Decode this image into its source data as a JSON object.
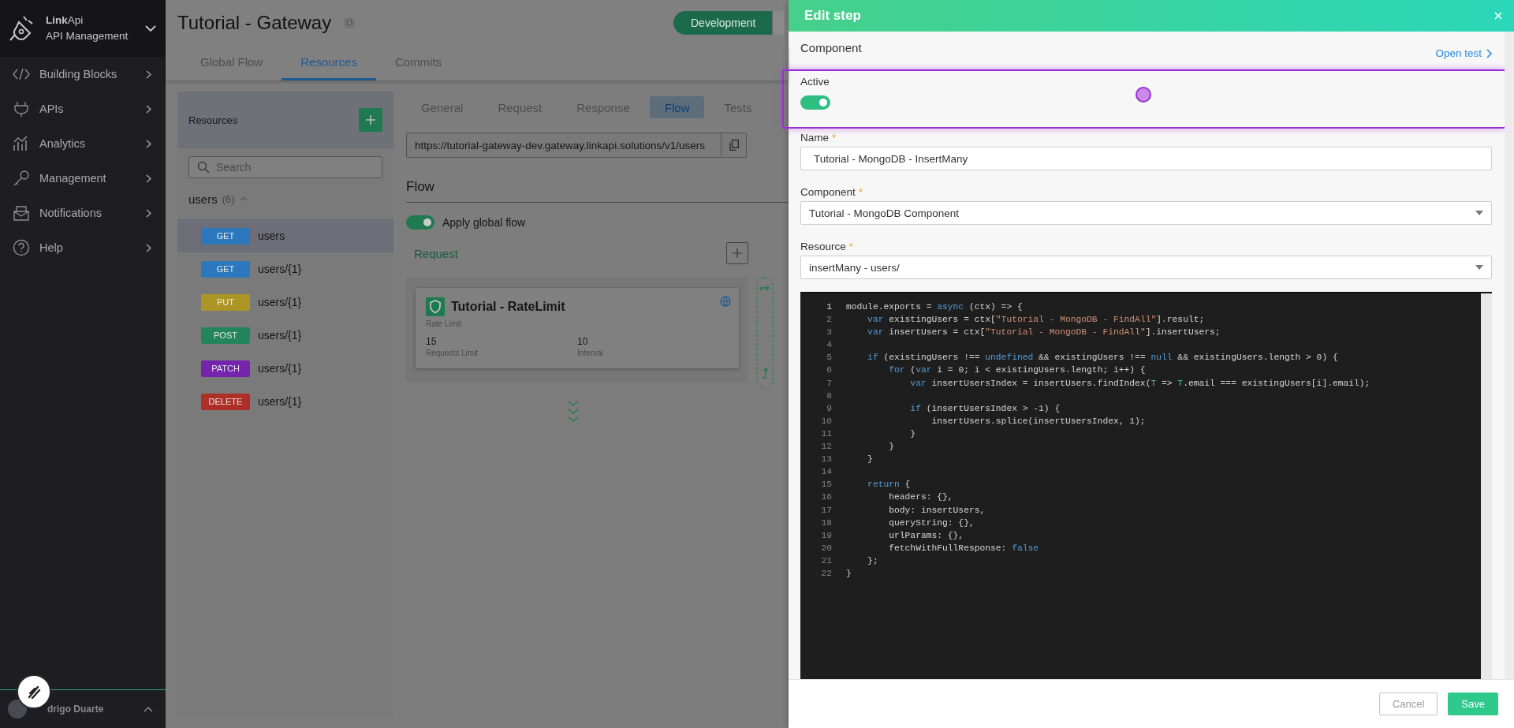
{
  "sidebar": {
    "brand": "**Link**Api",
    "subtitle": "API Management",
    "items": [
      {
        "label": "Building Blocks",
        "kind": "code"
      },
      {
        "label": "APIs",
        "kind": "plug"
      },
      {
        "label": "Analytics",
        "kind": "chart"
      },
      {
        "label": "Management",
        "kind": "key"
      },
      {
        "label": "Notifications",
        "kind": "mail"
      },
      {
        "label": "Help",
        "kind": "help"
      }
    ],
    "user": {
      "name": "drigo Duarte"
    }
  },
  "page": {
    "title": "Tutorial - Gateway",
    "environment": {
      "label": "Development",
      "selected": true
    },
    "tabs": [
      {
        "label": "Global Flow",
        "selected": false
      },
      {
        "label": "Resources",
        "selected": true
      },
      {
        "label": "Commits",
        "selected": false
      }
    ]
  },
  "resources": {
    "title": "Resources",
    "search": {
      "placeholder": "Search"
    },
    "group": {
      "name": "users",
      "count": "(6)",
      "expanded": true
    },
    "items": [
      {
        "method": "GET",
        "path": "users",
        "color": "#2b78bd",
        "selected": true
      },
      {
        "method": "GET",
        "path": "users/{1}",
        "color": "#2b78bd",
        "selected": false
      },
      {
        "method": "PUT",
        "path": "users/{1}",
        "color": "#ad9525",
        "selected": false
      },
      {
        "method": "POST",
        "path": "users/{1}",
        "color": "#23855b",
        "selected": false
      },
      {
        "method": "PATCH",
        "path": "users/{1}",
        "color": "#7424ad",
        "selected": false
      },
      {
        "method": "DELETE",
        "path": "users/{1}",
        "color": "#ad2f27",
        "selected": false
      }
    ]
  },
  "detail": {
    "tabs": [
      {
        "label": "General",
        "selected": false
      },
      {
        "label": "Request",
        "selected": false
      },
      {
        "label": "Response",
        "selected": false
      },
      {
        "label": "Flow",
        "selected": true
      },
      {
        "label": "Tests",
        "selected": false
      }
    ],
    "url": "https://tutorial-gateway-dev.gateway.linkapi.solutions/v1/users",
    "flow_title": "Flow",
    "apply_global_flow": {
      "label": "Apply global flow",
      "on": true
    },
    "request_title": "Request",
    "step": {
      "title": "Tutorial - RateLimit",
      "type": "Rate Limit",
      "metrics": [
        {
          "value": "15",
          "label": "Requests Limit"
        },
        {
          "value": "10",
          "label": "Interval"
        }
      ]
    }
  },
  "panel": {
    "title": "Edit step",
    "section": "Component",
    "open_test": "Open test",
    "active": {
      "label": "Active",
      "on": true
    },
    "fields": [
      {
        "label": "Name",
        "mark": "*",
        "kind": "text",
        "value": "Tutorial - MongoDB - InsertMany"
      },
      {
        "label": "Component",
        "mark": "*",
        "kind": "select",
        "value": "Tutorial - MongoDB Component"
      },
      {
        "label": "Resource",
        "mark": "*",
        "kind": "select",
        "value": "insertMany - users/"
      }
    ],
    "code": [
      {
        "n": "1",
        "tokens": [
          {
            "kind": "plain",
            "t": "module.exports = "
          },
          {
            "kind": "kw",
            "t": "async"
          },
          {
            "kind": "plain",
            "t": " (ctx) => {"
          }
        ]
      },
      {
        "n": "2",
        "tokens": [
          {
            "kind": "kw",
            "t": "    var"
          },
          {
            "kind": "plain",
            "t": " existingUsers = ctx["
          },
          {
            "kind": "str",
            "t": "\"Tutorial - MongoDB - FindAll\""
          },
          {
            "kind": "plain",
            "t": "].result;"
          }
        ]
      },
      {
        "n": "3",
        "tokens": [
          {
            "kind": "kw",
            "t": "    var"
          },
          {
            "kind": "plain",
            "t": " insertUsers = ctx["
          },
          {
            "kind": "str",
            "t": "\"Tutorial - MongoDB - FindAll\""
          },
          {
            "kind": "plain",
            "t": "].insertUsers;"
          }
        ]
      },
      {
        "n": "4"
      },
      {
        "n": "5",
        "tokens": [
          {
            "kind": "kw",
            "t": "    if"
          },
          {
            "kind": "plain",
            "t": " (existingUsers !== "
          },
          {
            "kind": "kw",
            "t": "undefined"
          },
          {
            "kind": "plain",
            "t": " && existingUsers !== "
          },
          {
            "kind": "kw",
            "t": "null"
          },
          {
            "kind": "plain",
            "t": " && existingUsers.length > 0) {"
          }
        ]
      },
      {
        "n": "6",
        "tokens": [
          {
            "kind": "kw",
            "t": "        for"
          },
          {
            "kind": "plain",
            "t": " ("
          },
          {
            "kind": "kw",
            "t": "var"
          },
          {
            "kind": "plain",
            "t": " i = 0; i < existingUsers.length; i++) {"
          }
        ]
      },
      {
        "n": "7",
        "tokens": [
          {
            "kind": "kw",
            "t": "            var"
          },
          {
            "kind": "plain",
            "t": " insertUsersIndex = insertUsers.findIndex("
          },
          {
            "kind": "param",
            "t": "T"
          },
          {
            "kind": "plain",
            "t": " => "
          },
          {
            "kind": "param",
            "t": "T"
          },
          {
            "kind": "plain",
            "t": ".email === existingUsers[i].email);"
          }
        ]
      },
      {
        "n": "8"
      },
      {
        "n": "9",
        "tokens": [
          {
            "kind": "kw",
            "t": "            if"
          },
          {
            "kind": "plain",
            "t": " (insertUsersIndex > -1) {"
          }
        ]
      },
      {
        "n": "10",
        "tokens": [
          {
            "kind": "plain",
            "t": "                insertUsers.splice(insertUsersIndex, 1);"
          }
        ]
      },
      {
        "n": "11",
        "tokens": [
          {
            "kind": "plain",
            "t": "            }"
          }
        ]
      },
      {
        "n": "12",
        "tokens": [
          {
            "kind": "plain",
            "t": "        }"
          }
        ]
      },
      {
        "n": "13",
        "tokens": [
          {
            "kind": "plain",
            "t": "    }"
          }
        ]
      },
      {
        "n": "14"
      },
      {
        "n": "15",
        "tokens": [
          {
            "kind": "kw",
            "t": "    return"
          },
          {
            "kind": "plain",
            "t": " {"
          }
        ]
      },
      {
        "n": "16",
        "tokens": [
          {
            "kind": "plain",
            "t": "        headers: {},"
          }
        ]
      },
      {
        "n": "17",
        "tokens": [
          {
            "kind": "plain",
            "t": "        body: insertUsers,"
          }
        ]
      },
      {
        "n": "18",
        "tokens": [
          {
            "kind": "plain",
            "t": "        queryString: {},"
          }
        ]
      },
      {
        "n": "19",
        "tokens": [
          {
            "kind": "plain",
            "t": "        urlParams: {},"
          }
        ]
      },
      {
        "n": "20",
        "tokens": [
          {
            "kind": "plain",
            "t": "        fetchWithFullResponse: "
          },
          {
            "kind": "kw",
            "t": "false"
          }
        ]
      },
      {
        "n": "21",
        "tokens": [
          {
            "kind": "plain",
            "t": "    };"
          }
        ]
      },
      {
        "n": "22",
        "tokens": [
          {
            "kind": "plain",
            "t": "}"
          }
        ]
      }
    ],
    "buttons": [
      {
        "label": "Cancel",
        "kind": "secondary"
      },
      {
        "label": "Save",
        "kind": "primary"
      }
    ]
  }
}
